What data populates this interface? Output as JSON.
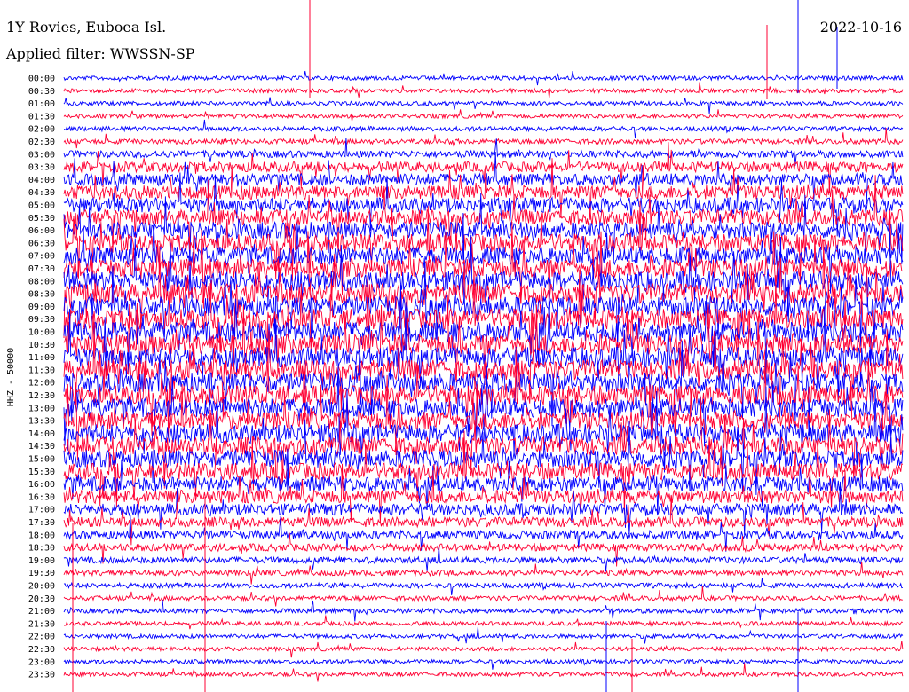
{
  "header": {
    "station": "1Y Rovies, Euboea Isl.",
    "date": "2022-10-16",
    "filter": "Applied filter: WWSSN-SP"
  },
  "y_axis_label": "HHZ - 50000",
  "colors": {
    "trace_a": "#0000ff",
    "trace_b": "#ff0033",
    "background": "#ffffff"
  },
  "chart_data": {
    "type": "line",
    "subtype": "helicorder",
    "title": "1Y Rovies, Euboea Isl.",
    "ylabel": "HHZ - 50000",
    "row_labels": [
      "00:00",
      "00:30",
      "01:00",
      "01:30",
      "02:00",
      "02:30",
      "03:00",
      "03:30",
      "04:00",
      "04:30",
      "05:00",
      "05:30",
      "06:00",
      "06:30",
      "07:00",
      "07:30",
      "08:00",
      "08:30",
      "09:00",
      "09:30",
      "10:00",
      "10:30",
      "11:00",
      "11:30",
      "12:00",
      "12:30",
      "13:00",
      "13:30",
      "14:00",
      "14:30",
      "15:00",
      "15:30",
      "16:00",
      "16:30",
      "17:00",
      "17:30",
      "18:00",
      "18:30",
      "19:00",
      "19:30",
      "20:00",
      "20:30",
      "21:00",
      "21:30",
      "22:00",
      "22:30",
      "23:00",
      "23:30"
    ],
    "row_minutes": 30,
    "noise_level": [
      0.9,
      0.9,
      0.9,
      0.9,
      1.0,
      1.1,
      1.5,
      2.2,
      2.6,
      3.0,
      3.2,
      3.4,
      3.6,
      3.8,
      4.0,
      4.1,
      4.2,
      4.3,
      4.3,
      4.4,
      4.4,
      4.4,
      4.4,
      4.3,
      4.3,
      4.2,
      4.1,
      4.0,
      4.0,
      3.9,
      3.8,
      3.6,
      3.3,
      2.9,
      2.5,
      2.1,
      1.8,
      1.6,
      1.4,
      1.2,
      1.1,
      1.0,
      1.0,
      0.9,
      0.9,
      0.9,
      0.9,
      0.9
    ],
    "grid": false,
    "series": [
      {
        "color": "#0000ff",
        "rows": "even"
      },
      {
        "color": "#ff0033",
        "rows": "odd"
      }
    ]
  }
}
